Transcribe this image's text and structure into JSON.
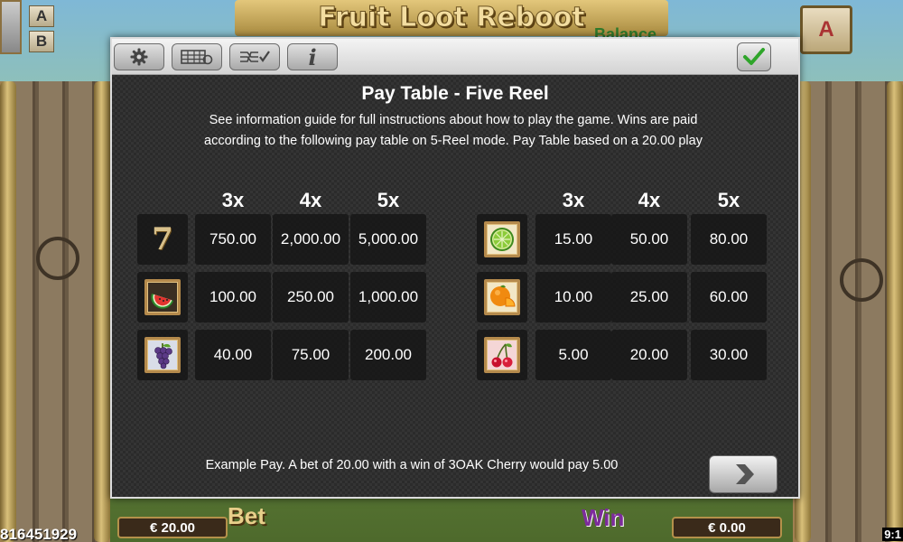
{
  "game": {
    "title": "Fruit Loot Reboot",
    "behind_text": "Balance",
    "ab_buttons": [
      "A",
      "B"
    ],
    "autoplay_label": "A",
    "balance_number": "816451929",
    "bet_label": "Bet",
    "bet_value": "€ 20.00",
    "win_label": "Win",
    "win_value": "€ 0.00",
    "clock": "9:1"
  },
  "toolbar": {
    "icons": [
      "gear-icon",
      "paytable-icon",
      "lines-icon",
      "info-icon",
      "checkmark-icon"
    ],
    "info_label": "i"
  },
  "paytable": {
    "heading": "Pay Table - Five Reel",
    "intro": "See information guide for full instructions about how to play the game. Wins are paid according to the following pay table on 5-Reel mode. Pay Table based on a 20.00 play",
    "column_headers": [
      "3x",
      "4x",
      "5x"
    ],
    "left": [
      {
        "symbol": "seven",
        "seven_glyph": "7",
        "values": [
          "750.00",
          "2,000.00",
          "5,000.00"
        ]
      },
      {
        "symbol": "watermelon",
        "values": [
          "100.00",
          "250.00",
          "1,000.00"
        ]
      },
      {
        "symbol": "grapes",
        "values": [
          "40.00",
          "75.00",
          "200.00"
        ]
      }
    ],
    "right": [
      {
        "symbol": "lime",
        "values": [
          "15.00",
          "50.00",
          "80.00"
        ]
      },
      {
        "symbol": "orange",
        "values": [
          "10.00",
          "25.00",
          "60.00"
        ]
      },
      {
        "symbol": "cherry",
        "values": [
          "5.00",
          "20.00",
          "30.00"
        ]
      }
    ],
    "example": "Example Pay. A bet of 20.00 with a win of 3OAK Cherry would pay 5.00"
  },
  "colors": {
    "dialog_bg": "#2b2b2b",
    "cell_bg": "#141414",
    "text": "#ffffff",
    "check_green": "#2fa52a",
    "frame_gold": "#b58a4c"
  }
}
